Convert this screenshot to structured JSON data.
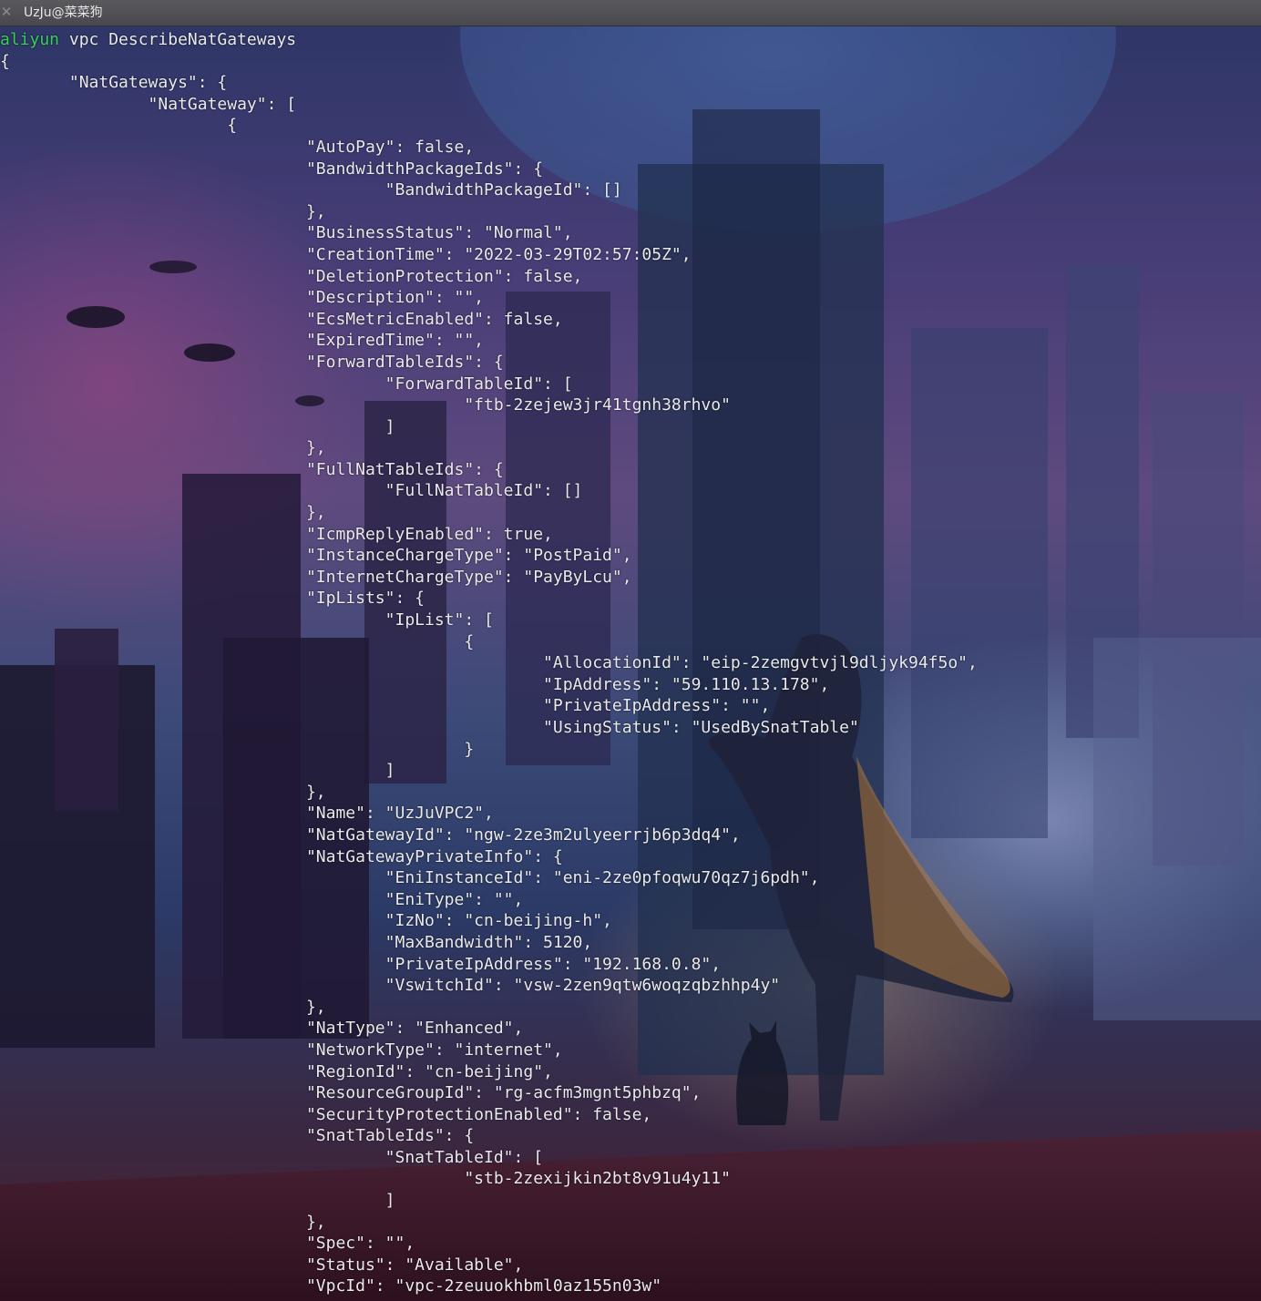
{
  "window": {
    "tab_title": "UzJu@菜菜狗"
  },
  "command": {
    "program": "aliyun",
    "args": " vpc DescribeNatGateways"
  },
  "output_lines": [
    "{",
    "       \"NatGateways\": {",
    "               \"NatGateway\": [",
    "                       {",
    "                               \"AutoPay\": false,",
    "                               \"BandwidthPackageIds\": {",
    "                                       \"BandwidthPackageId\": []",
    "                               },",
    "                               \"BusinessStatus\": \"Normal\",",
    "                               \"CreationTime\": \"2022-03-29T02:57:05Z\",",
    "                               \"DeletionProtection\": false,",
    "                               \"Description\": \"\",",
    "                               \"EcsMetricEnabled\": false,",
    "                               \"ExpiredTime\": \"\",",
    "                               \"ForwardTableIds\": {",
    "                                       \"ForwardTableId\": [",
    "                                               \"ftb-2zejew3jr41tgnh38rhvo\"",
    "                                       ]",
    "                               },",
    "                               \"FullNatTableIds\": {",
    "                                       \"FullNatTableId\": []",
    "                               },",
    "                               \"IcmpReplyEnabled\": true,",
    "                               \"InstanceChargeType\": \"PostPaid\",",
    "                               \"InternetChargeType\": \"PayByLcu\",",
    "                               \"IpLists\": {",
    "                                       \"IpList\": [",
    "                                               {",
    "                                                       \"AllocationId\": \"eip-2zemgvtvjl9dljyk94f5o\",",
    "                                                       \"IpAddress\": \"59.110.13.178\",",
    "                                                       \"PrivateIpAddress\": \"\",",
    "                                                       \"UsingStatus\": \"UsedBySnatTable\"",
    "                                               }",
    "                                       ]",
    "                               },",
    "                               \"Name\": \"UzJuVPC2\",",
    "                               \"NatGatewayId\": \"ngw-2ze3m2ulyeerrjb6p3dq4\",",
    "                               \"NatGatewayPrivateInfo\": {",
    "                                       \"EniInstanceId\": \"eni-2ze0pfoqwu70qz7j6pdh\",",
    "                                       \"EniType\": \"\",",
    "                                       \"IzNo\": \"cn-beijing-h\",",
    "                                       \"MaxBandwidth\": 5120,",
    "                                       \"PrivateIpAddress\": \"192.168.0.8\",",
    "                                       \"VswitchId\": \"vsw-2zen9qtw6woqzqbzhhp4y\"",
    "                               },",
    "                               \"NatType\": \"Enhanced\",",
    "                               \"NetworkType\": \"internet\",",
    "                               \"RegionId\": \"cn-beijing\",",
    "                               \"ResourceGroupId\": \"rg-acfm3mgnt5phbzq\",",
    "                               \"SecurityProtectionEnabled\": false,",
    "                               \"SnatTableIds\": {",
    "                                       \"SnatTableId\": [",
    "                                               \"stb-2zexijkin2bt8v91u4y11\"",
    "                                       ]",
    "                               },",
    "                               \"Spec\": \"\",",
    "                               \"Status\": \"Available\",",
    "                               \"VpcId\": \"vpc-2zeuuokhbml0az155n03w\""
  ],
  "colors": {
    "command": "#34d058",
    "output_text": "#e9e9ec",
    "titlebar": "#4f4f53"
  },
  "icons": {
    "close": "close-icon"
  }
}
